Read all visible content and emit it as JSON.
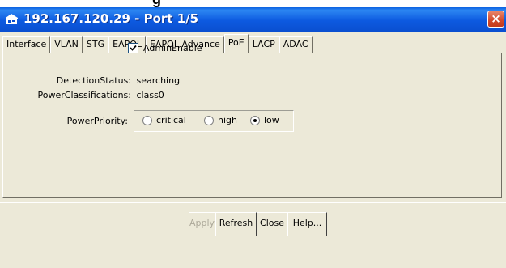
{
  "page_heading_cropped": "g",
  "window": {
    "title": "192.167.120.29 - Port 1/5",
    "close_label": "×"
  },
  "tabs": [
    {
      "label": "Interface"
    },
    {
      "label": "VLAN"
    },
    {
      "label": "STG"
    },
    {
      "label": "EAPOL"
    },
    {
      "label": "EAPOL Advance"
    },
    {
      "label": "PoE",
      "active": true
    },
    {
      "label": "LACP"
    },
    {
      "label": "ADAC"
    }
  ],
  "form": {
    "admin_enable": {
      "label": "AdminEnable",
      "checked": true
    },
    "detection_status": {
      "label": "DetectionStatus:",
      "value": "searching"
    },
    "power_classifications": {
      "label": "PowerClassifications:",
      "value": "class0"
    },
    "power_priority": {
      "label": "PowerPriority:",
      "options": [
        "critical",
        "high",
        "low"
      ],
      "selected": "low"
    }
  },
  "buttons": {
    "apply": "Apply",
    "refresh": "Refresh",
    "close": "Close",
    "help": "Help..."
  },
  "colors": {
    "titlebar": "#0a5ae0",
    "dialog_bg": "#ece9d8",
    "close_button": "#d1492b"
  }
}
